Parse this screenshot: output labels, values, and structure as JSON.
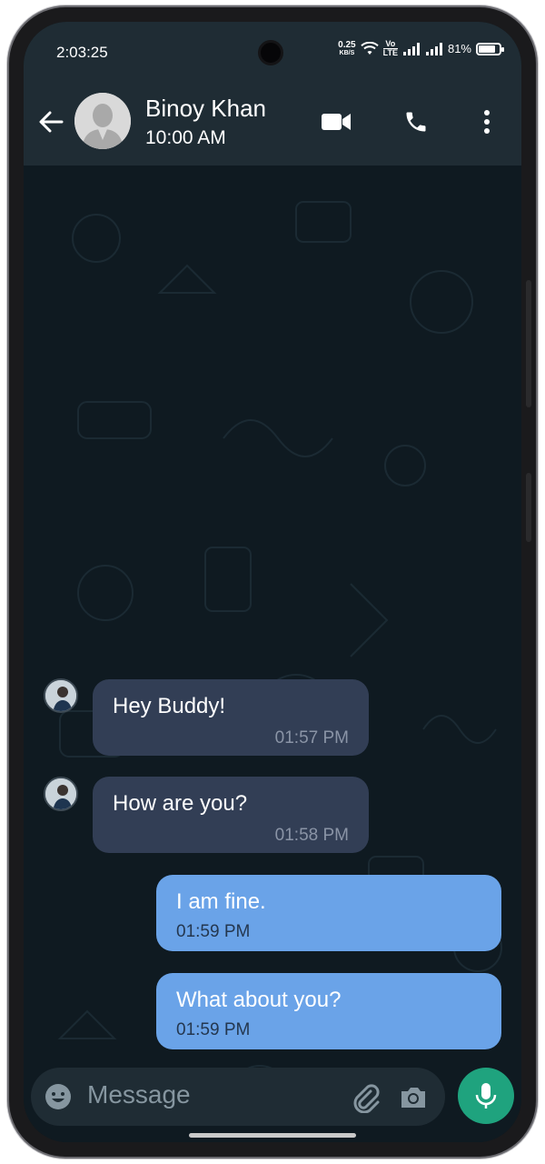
{
  "status_bar": {
    "time": "2:03:25",
    "net_speed_value": "0.25",
    "net_speed_unit": "KB/S",
    "volte_line1": "Vo",
    "volte_line2": "LTE",
    "battery_percent": "81%",
    "battery_level": 0.81
  },
  "header": {
    "contact_name": "Binoy Khan",
    "contact_status": "10:00 AM",
    "icons": [
      "back-arrow-icon",
      "video-call-icon",
      "voice-call-icon",
      "more-options-icon"
    ]
  },
  "messages": [
    {
      "direction": "incoming",
      "text": "Hey Buddy!",
      "time": "01:57 PM"
    },
    {
      "direction": "incoming",
      "text": "How are you?",
      "time": "01:58 PM"
    },
    {
      "direction": "outgoing",
      "text": "I am fine.",
      "time": "01:59 PM"
    },
    {
      "direction": "outgoing",
      "text": "What about you?",
      "time": "01:59 PM"
    }
  ],
  "composer": {
    "placeholder": "Message",
    "icons": [
      "emoji-icon",
      "attach-icon",
      "camera-icon",
      "mic-icon"
    ]
  },
  "colors": {
    "header_bg": "#1f2c34",
    "chat_bg": "#0f1a21",
    "incoming_bubble": "#323e55",
    "outgoing_bubble": "#6aa3e8",
    "mic_button": "#1fa37e"
  }
}
